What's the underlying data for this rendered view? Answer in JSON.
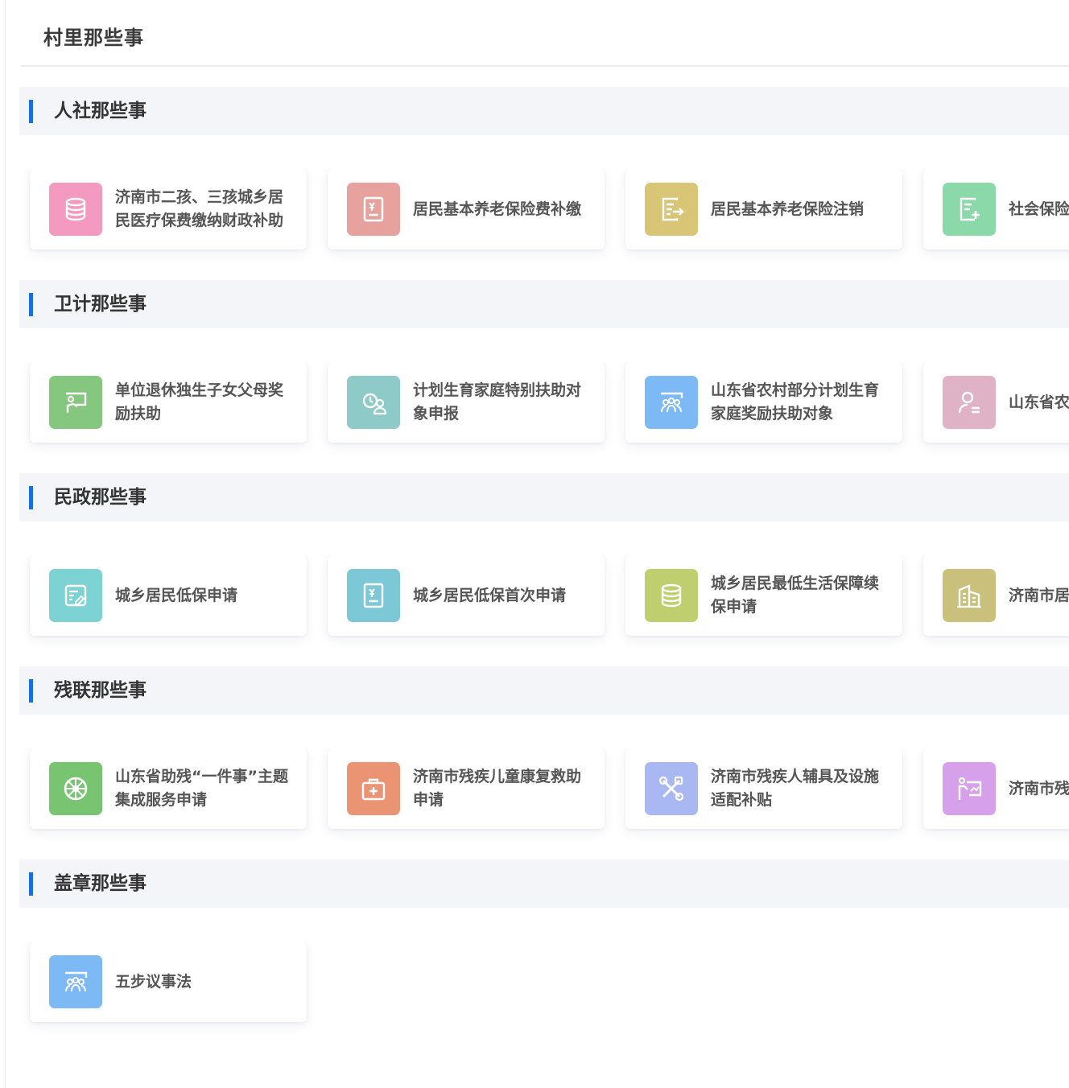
{
  "page": {
    "title": "村里那些事"
  },
  "sections": [
    {
      "title": "人社那些事",
      "items": [
        {
          "label": "济南市二孩、三孩城乡居民医疗保费缴纳财政补助",
          "icon": "coins-stack-icon",
          "color": "#f49ac1"
        },
        {
          "label": "居民基本养老保险费补缴",
          "icon": "receipt-yuan-icon",
          "color": "#e7a29e"
        },
        {
          "label": "居民基本养老保险注销",
          "icon": "document-export-icon",
          "color": "#d8c676"
        },
        {
          "label": "社会保险",
          "icon": "document-add-icon",
          "color": "#8bd8a8"
        }
      ]
    },
    {
      "title": "卫计那些事",
      "items": [
        {
          "label": "单位退休独生子女父母奖励扶助",
          "icon": "teaching-board-icon",
          "color": "#86c77f"
        },
        {
          "label": "计划生育家庭特别扶助对象申报",
          "icon": "user-clock-icon",
          "color": "#8dcac8"
        },
        {
          "label": "山东省农村部分计划生育家庭奖励扶助对象",
          "icon": "meeting-group-icon",
          "color": "#7cb9f5"
        },
        {
          "label": "山东省农庭奖励扶",
          "icon": "user-list-icon",
          "color": "#dfb2c6"
        }
      ]
    },
    {
      "title": "民政那些事",
      "items": [
        {
          "label": "城乡居民低保申请",
          "icon": "form-edit-icon",
          "color": "#7dd3d3"
        },
        {
          "label": "城乡居民低保首次申请",
          "icon": "receipt-yuan-icon",
          "color": "#7dc8d6"
        },
        {
          "label": "城乡居民最低生活保障续保申请",
          "icon": "coins-stack-icon",
          "color": "#bfcf6f"
        },
        {
          "label": "济南市居用申请",
          "icon": "building-icon",
          "color": "#c9c07c"
        }
      ]
    },
    {
      "title": "残联那些事",
      "items": [
        {
          "label": "山东省助残“一件事”主题集成服务申请",
          "icon": "wheel-icon",
          "color": "#78c470"
        },
        {
          "label": "济南市残疾儿童康复救助申请",
          "icon": "medical-kit-icon",
          "color": "#eb9474"
        },
        {
          "label": "济南市残疾人辅具及设施适配补贴",
          "icon": "tools-icon",
          "color": "#a9b8f2"
        },
        {
          "label": "济南市残请",
          "icon": "presentation-icon",
          "color": "#d7a0ea"
        }
      ]
    },
    {
      "title": "盖章那些事",
      "items": [
        {
          "label": "五步议事法",
          "icon": "meeting-group-icon",
          "color": "#7cb9f5"
        }
      ]
    }
  ]
}
